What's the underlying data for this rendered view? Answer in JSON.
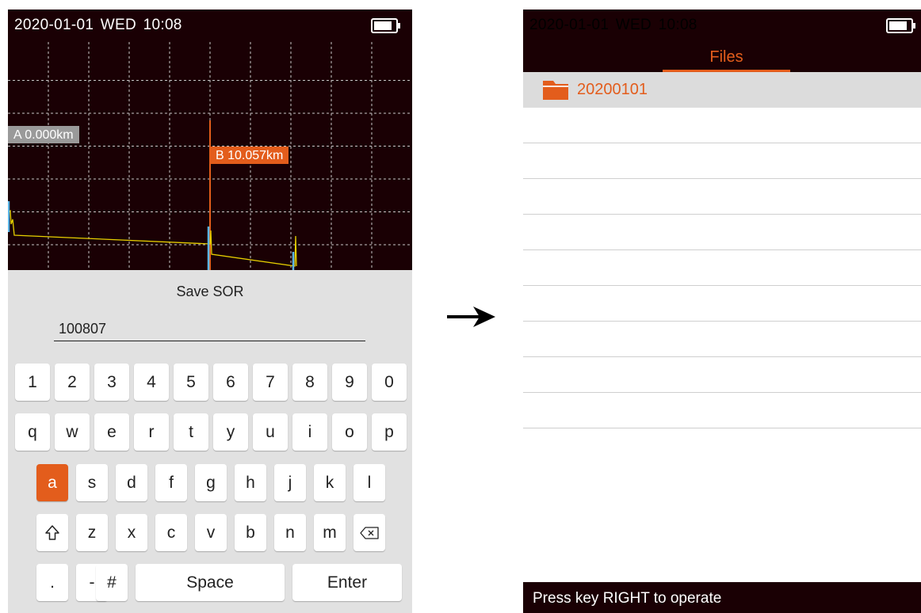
{
  "left_screen": {
    "status": {
      "date": "2020-01-01",
      "weekday": "WED",
      "time": "10:08"
    },
    "markers": {
      "a_label": "A  0.000km",
      "b_label": "B  10.057km"
    },
    "dialog": {
      "title": "Save SOR",
      "filename_value": "100807"
    },
    "keyboard": {
      "row_numbers": [
        "1",
        "2",
        "3",
        "4",
        "5",
        "6",
        "7",
        "8",
        "9",
        "0"
      ],
      "row_top": [
        "q",
        "w",
        "e",
        "r",
        "t",
        "y",
        "u",
        "i",
        "o",
        "p"
      ],
      "row_middle": [
        "a",
        "s",
        "d",
        "f",
        "g",
        "h",
        "j",
        "k",
        "l"
      ],
      "row_bottom": [
        "z",
        "x",
        "c",
        "v",
        "b",
        "n",
        "m"
      ],
      "dot_label": ".",
      "dash_label": "-",
      "hash_label": "#",
      "space_label": "Space",
      "enter_label": "Enter",
      "active_key": "a"
    }
  },
  "right_screen": {
    "status": {
      "date": "2020-01-01",
      "weekday": "WED",
      "time": "10:08"
    },
    "tab_label": "Files",
    "files": [
      {
        "name": "20200101",
        "type": "folder"
      }
    ],
    "footer_hint": "Press key RIGHT to operate"
  },
  "icons": {
    "shift": "shift-icon",
    "backspace": "backspace-icon",
    "folder": "folder-icon",
    "battery": "battery-icon",
    "arrow": "right-arrow-icon"
  },
  "colors": {
    "screen_background": "#1a0004",
    "accent": "#e35d1c",
    "trace": "#e6d000",
    "event_marker": "#5ab4e6",
    "keyboard_background": "#e1e1e1"
  }
}
